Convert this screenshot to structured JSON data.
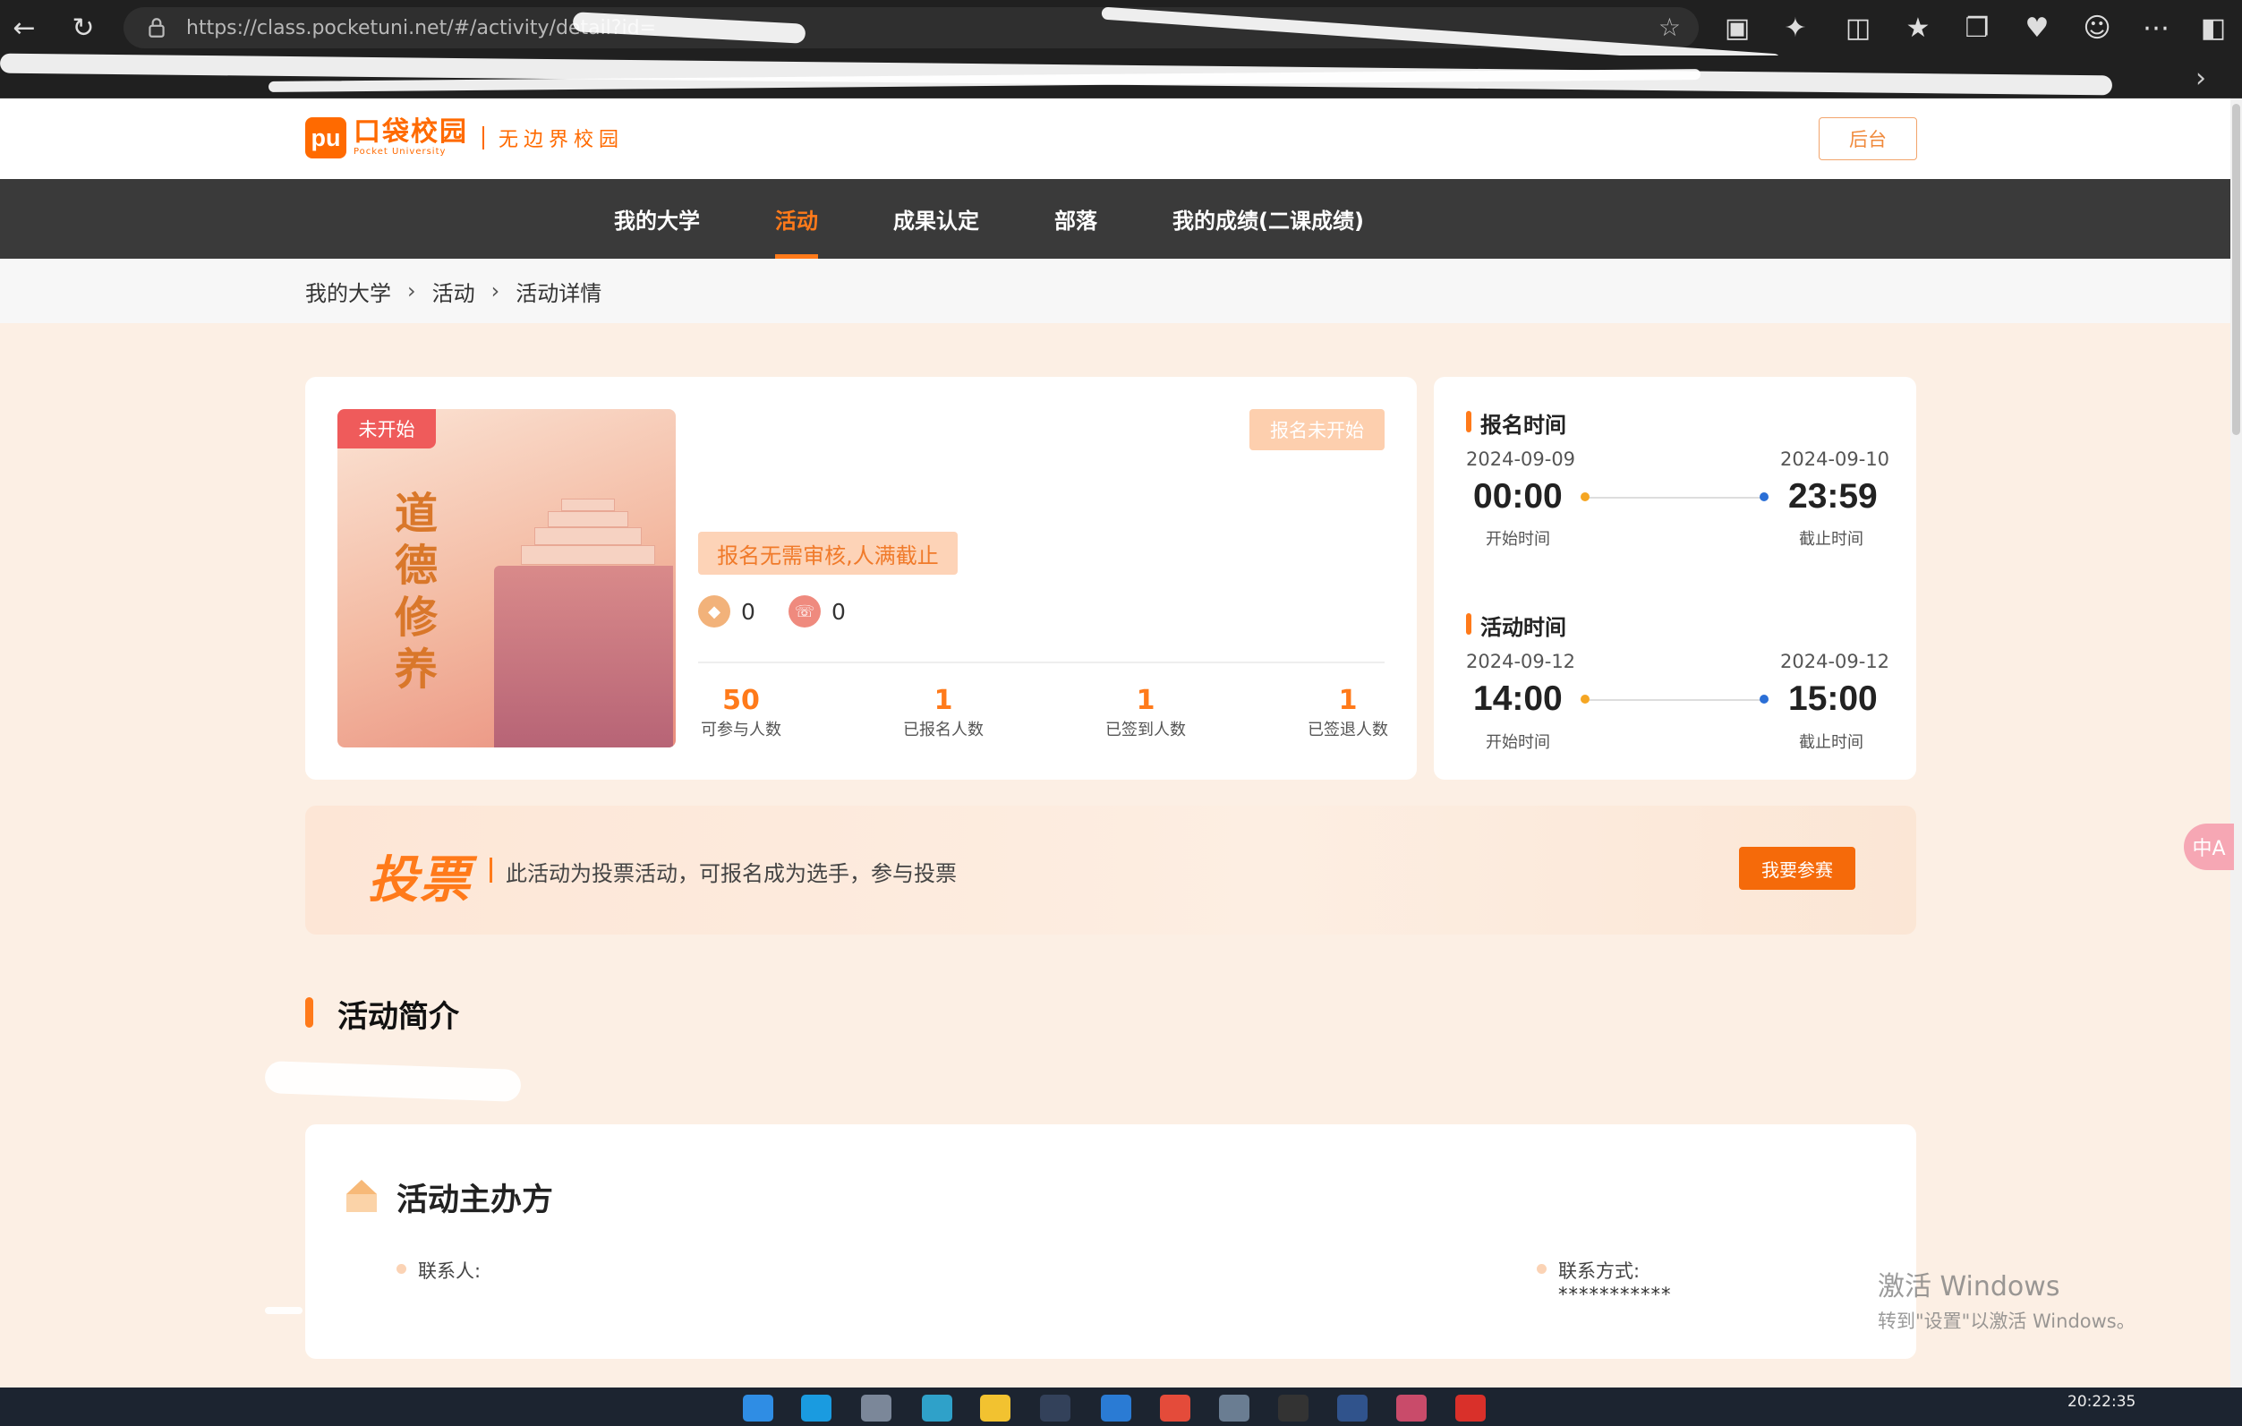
{
  "browser": {
    "url": "https://class.pocketuni.net/#/activity/detail?id=",
    "back_icon": "back-arrow-icon",
    "reload_icon": "reload-icon"
  },
  "header": {
    "logo_mark": "pu",
    "logo_cn": "口袋校园",
    "logo_en": "Pocket University",
    "slogan": "无边界校园",
    "admin_button": "后台"
  },
  "nav": {
    "items": [
      {
        "label": "我的大学",
        "active": false
      },
      {
        "label": "活动",
        "active": true
      },
      {
        "label": "成果认定",
        "active": false
      },
      {
        "label": "部落",
        "active": false
      },
      {
        "label": "我的成绩(二课成绩)",
        "active": false
      }
    ]
  },
  "breadcrumb": [
    "我的大学",
    "活动",
    "活动详情"
  ],
  "activity": {
    "status_tag": "未开始",
    "poster_text": "道德修养",
    "registration_status": "报名未开始",
    "registration_rule": "报名无需审核,人满截止",
    "counters": [
      {
        "icon": "like-icon",
        "value": "0"
      },
      {
        "icon": "phone-icon",
        "value": "0"
      }
    ],
    "stats": [
      {
        "value": "50",
        "label": "可参与人数"
      },
      {
        "value": "1",
        "label": "已报名人数"
      },
      {
        "value": "1",
        "label": "已签到人数"
      },
      {
        "value": "1",
        "label": "已签退人数"
      }
    ]
  },
  "times": {
    "registration": {
      "title": "报名时间",
      "start_date": "2024-09-09",
      "start_time": "00:00",
      "start_label": "开始时间",
      "end_date": "2024-09-10",
      "end_time": "23:59",
      "end_label": "截止时间"
    },
    "activity": {
      "title": "活动时间",
      "start_date": "2024-09-12",
      "start_time": "14:00",
      "start_label": "开始时间",
      "end_date": "2024-09-12",
      "end_time": "15:00",
      "end_label": "截止时间"
    }
  },
  "vote": {
    "title": "投票",
    "description": "此活动为投票活动，可报名成为选手，参与投票",
    "join_button": "我要参赛"
  },
  "intro": {
    "title": "活动简介"
  },
  "organizer": {
    "title": "活动主办方",
    "contact_label": "联系人:",
    "phone_label": "联系方式:",
    "phone_value": "***********"
  },
  "translate_fab": "中A",
  "watermark": {
    "line1": "激活 Windows",
    "line2": "转到\"设置\"以激活 Windows。"
  },
  "taskbar": {
    "clock": "20:22:35"
  },
  "colors": {
    "accent": "#ff7a1a",
    "nav_bg": "#3a3a3a",
    "page_bg": "#fcefe4"
  }
}
